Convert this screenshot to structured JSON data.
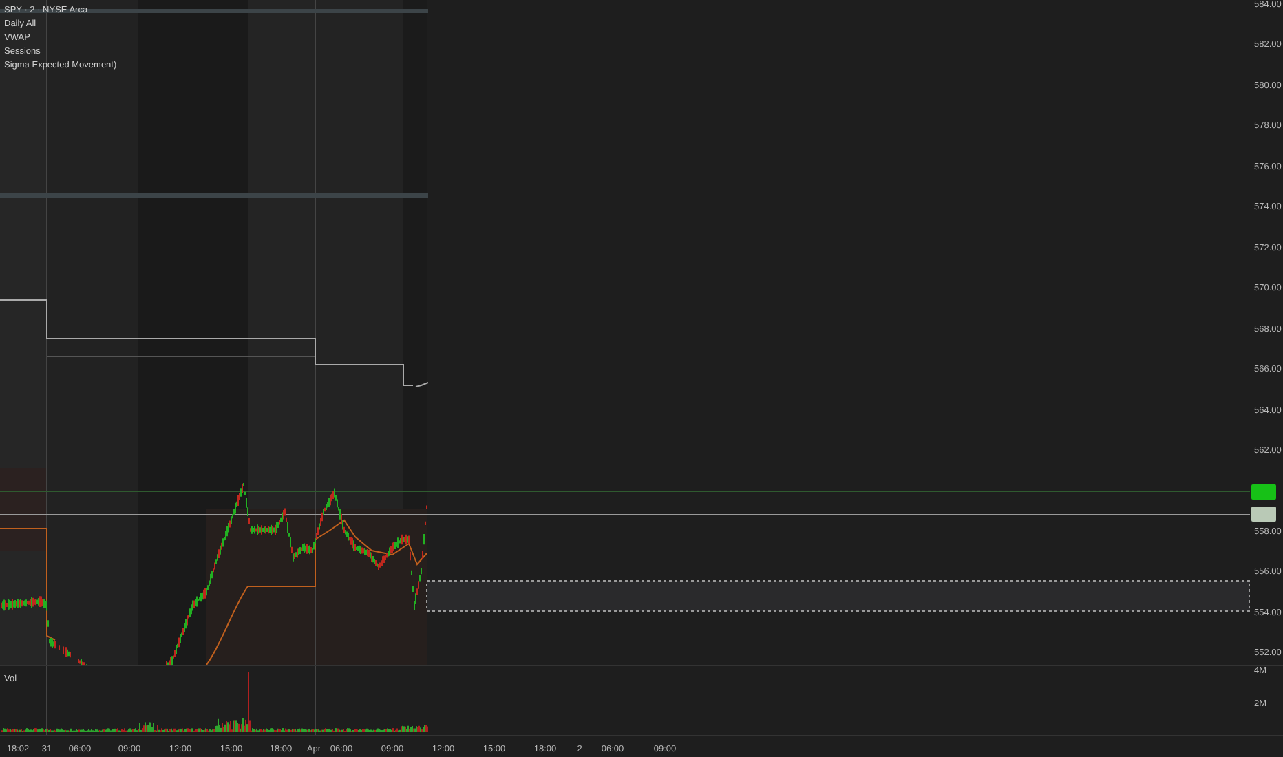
{
  "legend": [
    "SPY · 2 · NYSE Arca",
    "Daily All",
    "VWAP",
    "Sessions",
    "Sigma Expected Movement)"
  ],
  "price_axis": [
    "584.00",
    "582.00",
    "580.00",
    "578.00",
    "576.00",
    "574.00",
    "572.00",
    "570.00",
    "568.00",
    "566.00",
    "564.00",
    "562.00",
    "558.00",
    "556.00",
    "554.00",
    "552.00"
  ],
  "volume_pane": {
    "label": "Vol",
    "axis": [
      "4M",
      "2M"
    ]
  },
  "time_axis": [
    "18:02",
    "31",
    "06:00",
    "09:00",
    "12:00",
    "15:00",
    "18:00",
    "Apr",
    "06:00",
    "09:00",
    "12:00",
    "15:00",
    "18:00",
    "2",
    "06:00",
    "09:00"
  ]
}
